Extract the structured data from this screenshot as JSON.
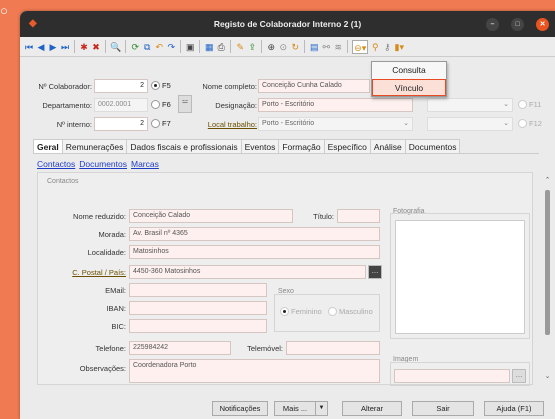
{
  "window": {
    "title": "Registo de Colaborador Interno 2 (1)"
  },
  "vinculo_menu": {
    "items": [
      "Consulta",
      "Vínculo"
    ],
    "highlighted": "Vínculo"
  },
  "header": {
    "numero_colaborador_label": "Nº Colaborador:",
    "numero_colaborador": "2",
    "f5_label": "F5",
    "departamento_label": "Departamento:",
    "departamento": "0002.0001",
    "f6_label": "F6",
    "numero_interno_label": "Nº interno:",
    "numero_interno": "2",
    "f7_label": "F7",
    "nome_completo_label": "Nome completo:",
    "nome_completo": "Conceição Cunha Calado",
    "designacao_label": "Designação:",
    "designacao": "Porto - Escritório",
    "local_trabalho_label": "Local trabalho:",
    "local_trabalho": "Porto - Escritório",
    "f11_label": "F11",
    "f12_label": "F12"
  },
  "tabs": [
    "Geral",
    "Remunerações",
    "Dados fiscais e profissionais",
    "Eventos",
    "Formação",
    "Específico",
    "Análise",
    "Documentos"
  ],
  "active_tab": "Geral",
  "sublinks": [
    "Contactos",
    "Documentos",
    "Marcas"
  ],
  "contactos": {
    "group_title": "Contactos",
    "nome_reduzido_label": "Nome reduzido:",
    "nome_reduzido": "Conceição Calado",
    "titulo_label": "Título:",
    "morada_label": "Morada:",
    "morada": "Av. Brasil nº 4365",
    "localidade_label": "Localidade:",
    "localidade": "Matosinhos",
    "cpostal_label": "C. Postal / País:",
    "cpostal": "4450-360 Matosinhos",
    "email_label": "EMail:",
    "iban_label": "IBAN:",
    "bic_label": "BIC:",
    "telefone_label": "Telefone:",
    "telefone": "225984242",
    "telemovel_label": "Telemóvel:",
    "observacoes_label": "Observações:",
    "observacoes": "Coordenadora Porto",
    "sexo_title": "Sexo",
    "sexo_options": [
      "Feminino",
      "Masculino"
    ],
    "fotografia_title": "Fotografia",
    "imagem_title": "Imagem"
  },
  "buttons": {
    "notificacoes": "Notificações",
    "mais": "Mais ...",
    "alterar": "Alterar",
    "sair": "Sair",
    "ajuda": "Ajuda (F1)"
  },
  "colors": {
    "accent": "#e84a23",
    "desktop": "#f07a52",
    "titlebar": "#2e2e2e"
  }
}
